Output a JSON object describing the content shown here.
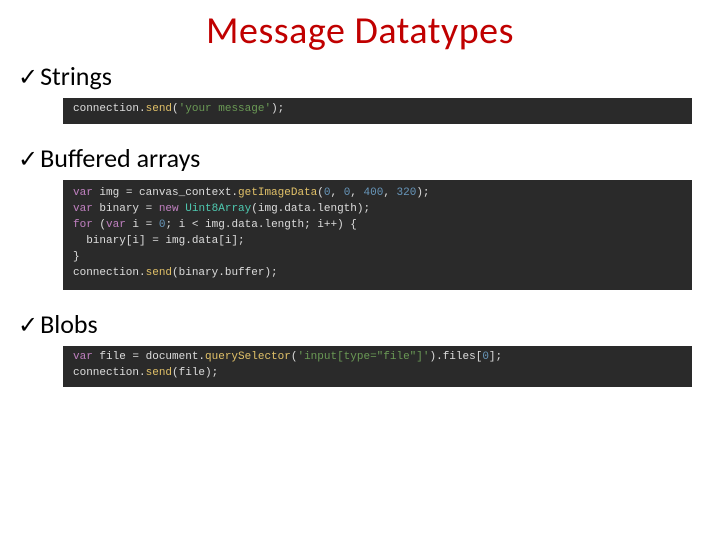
{
  "title": "Message Datatypes",
  "checkmark": "✓",
  "sections": {
    "strings": {
      "heading": "Strings"
    },
    "buffered": {
      "heading": "Buffered arrays"
    },
    "blobs": {
      "heading": "Blobs"
    }
  },
  "code": {
    "strings": {
      "l1_a": "connection.",
      "l1_b": "send",
      "l1_c": "(",
      "l1_d": "'your message'",
      "l1_e": ");"
    },
    "buffered": {
      "l1_a": "var",
      "l1_b": " img = canvas_context.",
      "l1_c": "getImageData",
      "l1_d": "(",
      "l1_e": "0",
      "l1_f": ", ",
      "l1_g": "0",
      "l1_h": ", ",
      "l1_i": "400",
      "l1_j": ", ",
      "l1_k": "320",
      "l1_l": ");",
      "l2_a": "var",
      "l2_b": " binary = ",
      "l2_c": "new",
      "l2_d": " ",
      "l2_e": "Uint8Array",
      "l2_f": "(img.data.length);",
      "l3_a": "for",
      "l3_b": " (",
      "l3_c": "var",
      "l3_d": " i = ",
      "l3_e": "0",
      "l3_f": "; i < img.data.length; i++) {",
      "l4": "  binary[i] = img.data[i];",
      "l5": "}",
      "l6_a": "connection.",
      "l6_b": "send",
      "l6_c": "(binary.buffer);"
    },
    "blobs": {
      "l1_a": "var",
      "l1_b": " file = document.",
      "l1_c": "querySelector",
      "l1_d": "(",
      "l1_e": "'input[type=\"file\"]'",
      "l1_f": ").files[",
      "l1_g": "0",
      "l1_h": "];",
      "l2_a": "connection.",
      "l2_b": "send",
      "l2_c": "(file);"
    }
  }
}
